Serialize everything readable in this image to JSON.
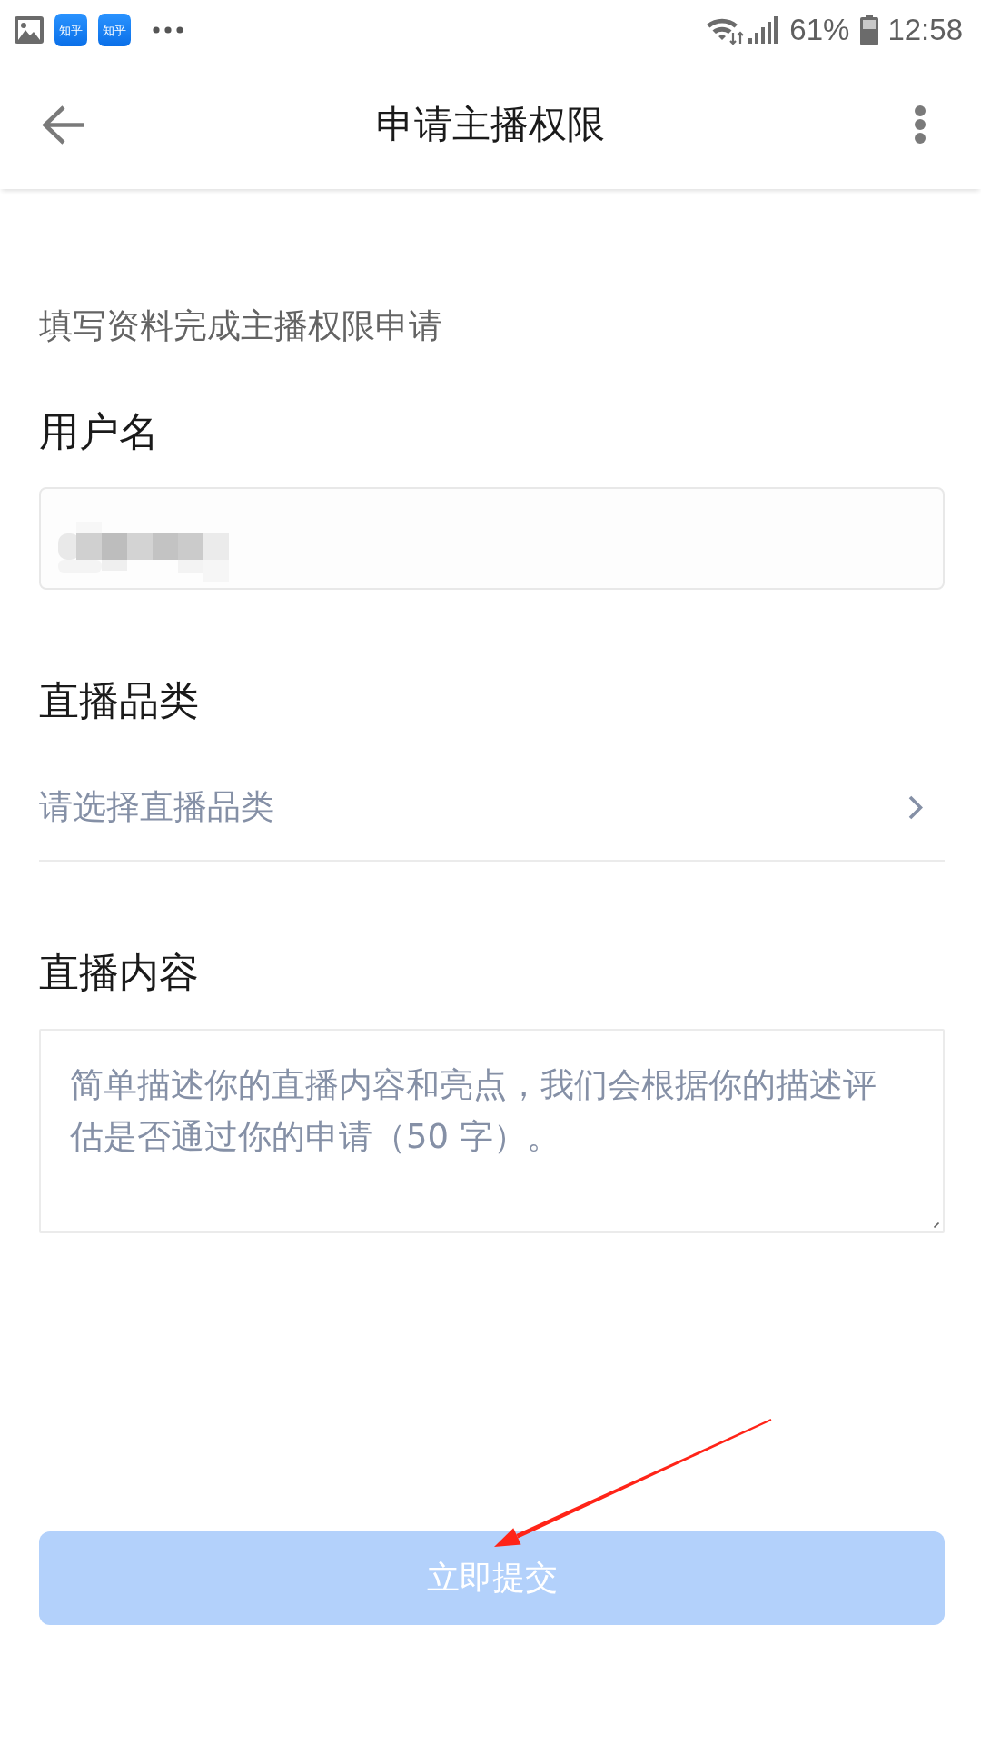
{
  "status_bar": {
    "notifications": [
      {
        "kind": "gallery"
      },
      {
        "kind": "app",
        "label": "知乎"
      },
      {
        "kind": "app",
        "label": "知乎"
      },
      {
        "kind": "more"
      }
    ],
    "battery_percent": "61%",
    "time": "12:58"
  },
  "header": {
    "title": "申请主播权限"
  },
  "form": {
    "intro": "填写资料完成主播权限申请",
    "fields": [
      {
        "kind": "input",
        "label": "用户名",
        "redacted": true
      },
      {
        "kind": "select",
        "label": "直播品类",
        "placeholder": "请选择直播品类"
      },
      {
        "kind": "textarea",
        "label": "直播内容",
        "placeholder": "简单描述你的直播内容和亮点，我们会根据你的描述评估是否通过你的申请（50 字）。"
      }
    ]
  },
  "submit_button": {
    "label": "立即提交",
    "disabled": true
  },
  "annotations": [
    {
      "kind": "arrow"
    }
  ]
}
